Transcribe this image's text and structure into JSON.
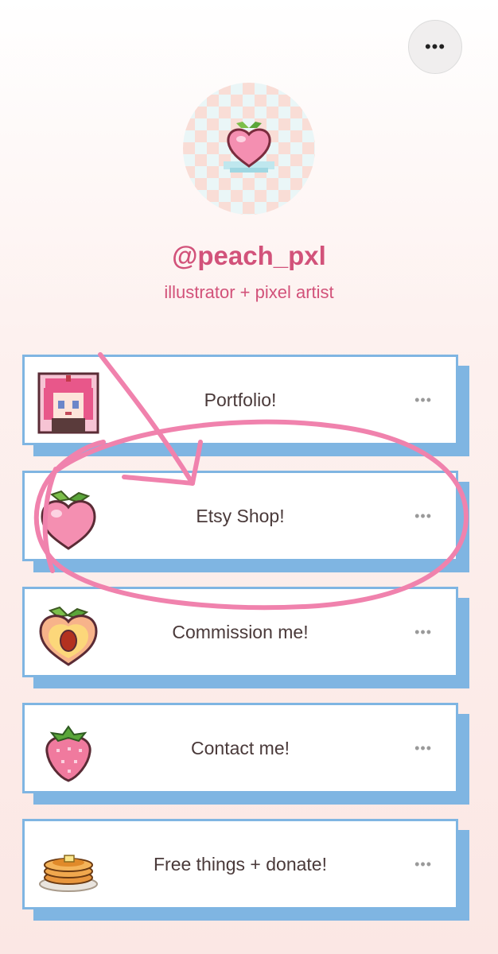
{
  "header": {
    "more_label": "•••"
  },
  "profile": {
    "username": "@peach_pxl",
    "bio": "illustrator + pixel artist"
  },
  "links": [
    {
      "label": "Portfolio!",
      "icon": "pixel-character-icon",
      "more": "•••"
    },
    {
      "label": "Etsy Shop!",
      "icon": "peach-icon",
      "more": "•••"
    },
    {
      "label": "Commission me!",
      "icon": "peach-half-icon",
      "more": "•••"
    },
    {
      "label": "Contact me!",
      "icon": "strawberry-icon",
      "more": "•••"
    },
    {
      "label": "Free things + donate!",
      "icon": "pancakes-icon",
      "more": "•••"
    }
  ],
  "colors": {
    "accent": "#d2527a",
    "card_border": "#7fb5e2",
    "annotation": "#f082ad"
  }
}
